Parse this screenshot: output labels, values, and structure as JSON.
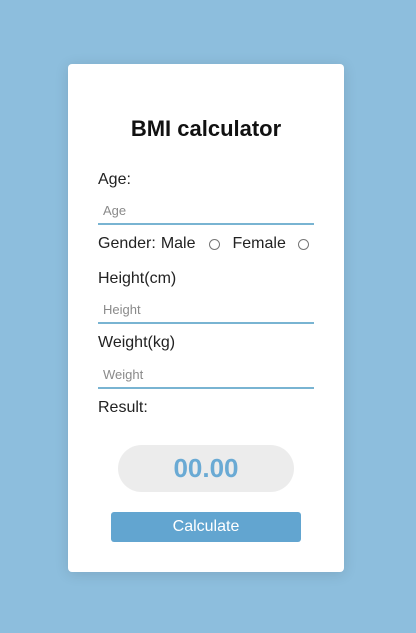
{
  "calculator": {
    "title": "BMI calculator",
    "age": {
      "label": "Age:",
      "placeholder": "Age",
      "value": ""
    },
    "gender": {
      "label": "Gender:",
      "options": [
        {
          "label": "Male",
          "selected": false
        },
        {
          "label": "Female",
          "selected": false
        }
      ]
    },
    "height": {
      "label": "Height(cm)",
      "placeholder": "Height",
      "value": ""
    },
    "weight": {
      "label": "Weight(kg)",
      "placeholder": "Weight",
      "value": ""
    },
    "result": {
      "label": "Result:",
      "value": "00.00"
    },
    "calculate_label": "Calculate"
  },
  "colors": {
    "background": "#8dbedd",
    "card": "#ffffff",
    "input_underline": "#79b4d2",
    "result_text": "#6aaad4",
    "result_pill": "#ececec",
    "button": "#62a5d0"
  }
}
